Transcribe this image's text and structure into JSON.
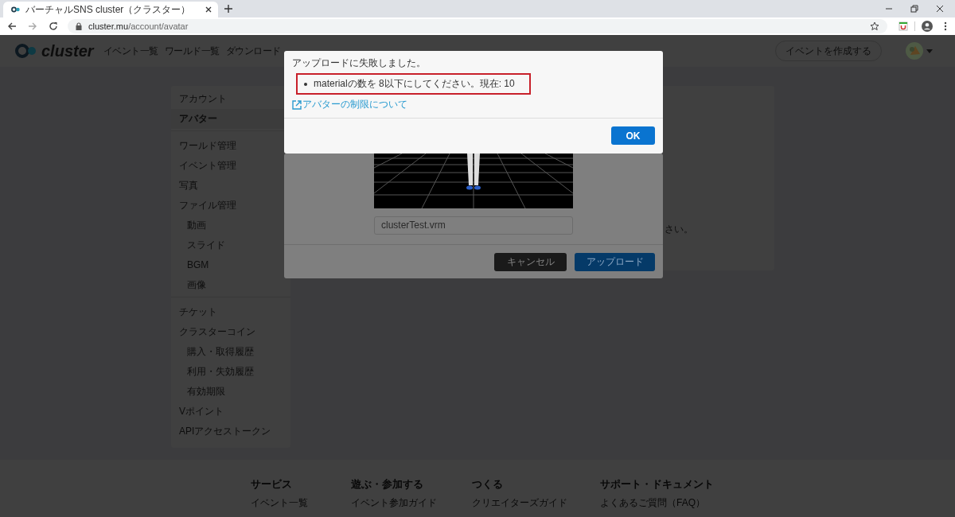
{
  "browser": {
    "tab_title": "バーチャルSNS cluster（クラスター）",
    "url_host": "cluster.mu",
    "url_path": "/account/avatar"
  },
  "site_header": {
    "logo": "cluster",
    "nav": [
      "イベント一覧",
      "ワールド一覧",
      "ダウンロード"
    ],
    "create_event_button": "イベントを作成する"
  },
  "sidebar": {
    "groups": [
      [
        {
          "label": "アカウント",
          "selected": false
        },
        {
          "label": "アバター",
          "selected": true
        }
      ],
      [
        {
          "label": "ワールド管理",
          "selected": false
        },
        {
          "label": "イベント管理",
          "selected": false
        },
        {
          "label": "写真",
          "selected": false
        },
        {
          "label": "ファイル管理",
          "selected": false,
          "children": [
            {
              "label": "動画",
              "selected": false
            },
            {
              "label": "スライド",
              "selected": false
            },
            {
              "label": "BGM",
              "selected": false
            },
            {
              "label": "画像",
              "selected": false
            }
          ]
        }
      ],
      [
        {
          "label": "チケット",
          "selected": false
        },
        {
          "label": "クラスターコイン",
          "selected": false,
          "children": [
            {
              "label": "購入・取得履歴",
              "selected": false
            },
            {
              "label": "利用・失効履歴",
              "selected": false
            },
            {
              "label": "有効期限",
              "selected": false
            }
          ]
        },
        {
          "label": "Vポイント",
          "selected": false
        },
        {
          "label": "APIアクセストークン",
          "selected": false
        }
      ]
    ]
  },
  "main_card": {
    "text_fragment": "さい。"
  },
  "upload_dialog": {
    "file_name": "clusterTest.vrm",
    "buttons": [
      {
        "label": "キャンセル",
        "kind": "secondary"
      },
      {
        "label": "アップロード",
        "kind": "primary"
      }
    ]
  },
  "error_dialog": {
    "title": "アップロードに失敗しました。",
    "errors": [
      "materialの数を 8以下にしてください。現在: 10"
    ],
    "link": "アバターの制限について",
    "ok_button": "OK"
  },
  "footer": {
    "columns": [
      {
        "heading": "サービス",
        "links": [
          "イベント一覧"
        ]
      },
      {
        "heading": "遊ぶ・参加する",
        "links": [
          "イベント参加ガイド"
        ]
      },
      {
        "heading": "つくる",
        "links": [
          "クリエイターズガイド"
        ]
      },
      {
        "heading": "サポート・ドキュメント",
        "links": [
          "よくあるご質問（FAQ）"
        ]
      }
    ]
  }
}
